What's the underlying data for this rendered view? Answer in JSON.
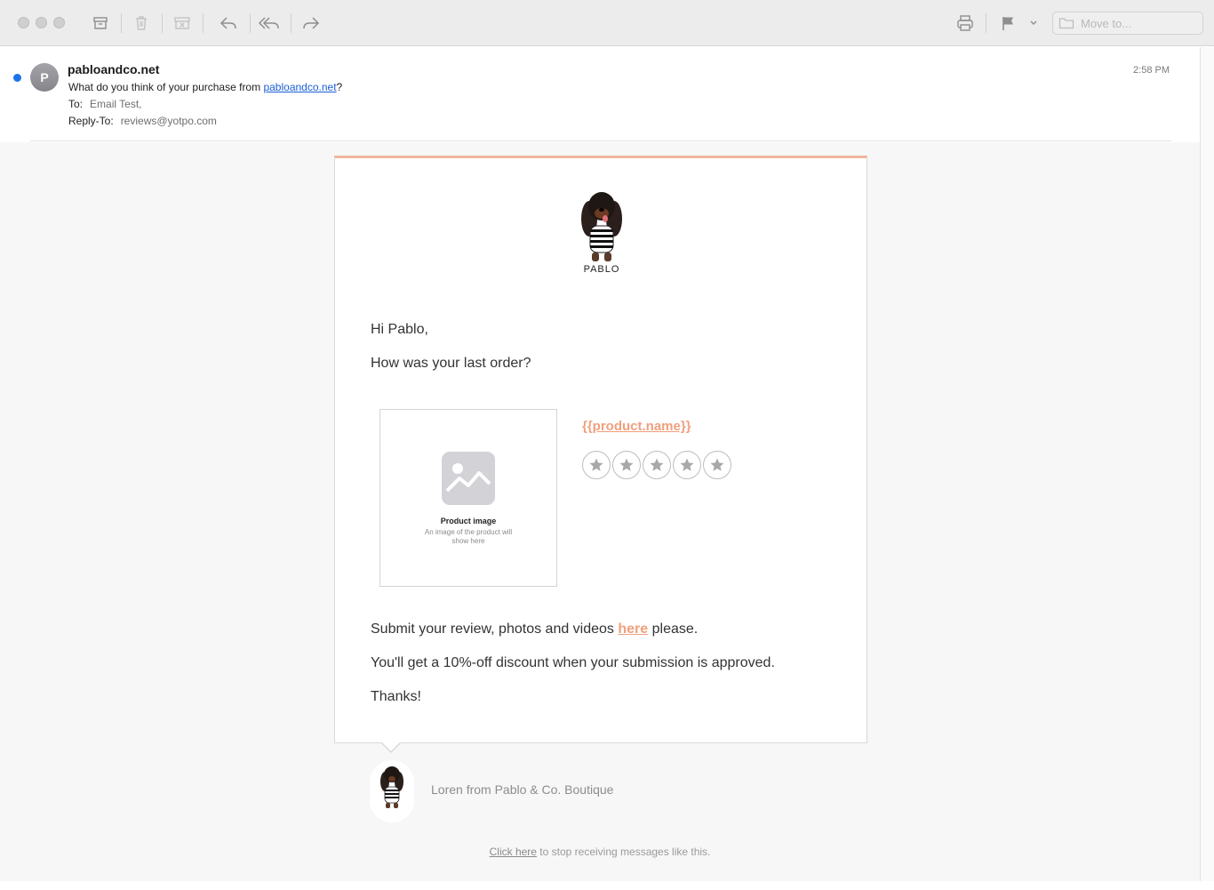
{
  "toolbar": {
    "move_to_placeholder": "Move to..."
  },
  "header": {
    "avatar_letter": "P",
    "sender": "pabloandco.net",
    "subject_prefix": "What do you think of your purchase from ",
    "subject_link": "pabloandco.net",
    "subject_suffix": "?",
    "to_label": "To:",
    "to_value": "Email Test,",
    "reply_to_label": "Reply-To:",
    "reply_to_value": "reviews@yotpo.com",
    "time": "2:58 PM"
  },
  "email": {
    "logo_text": "PABLO",
    "greeting": "Hi Pablo,",
    "question": "How was your last order?",
    "product_image_title": "Product image",
    "product_image_desc": "An image of the product will show here",
    "product_name": "{{product.name}}",
    "star_count": 5,
    "submit_prefix": "Submit your review, photos and videos ",
    "submit_link": "here",
    "submit_suffix": " please.",
    "discount": "You'll get a 10%-off discount when your submission is approved.",
    "thanks": "Thanks!",
    "signature": "Loren from Pablo & Co. Boutique",
    "unsubscribe_link": "Click here",
    "unsubscribe_suffix": " to stop receiving messages like this."
  },
  "colors": {
    "accent": "#f0a07e",
    "card_top_border": "#f0b69d",
    "link_blue": "#1a5ed8",
    "unread_dot": "#1b73e8"
  }
}
